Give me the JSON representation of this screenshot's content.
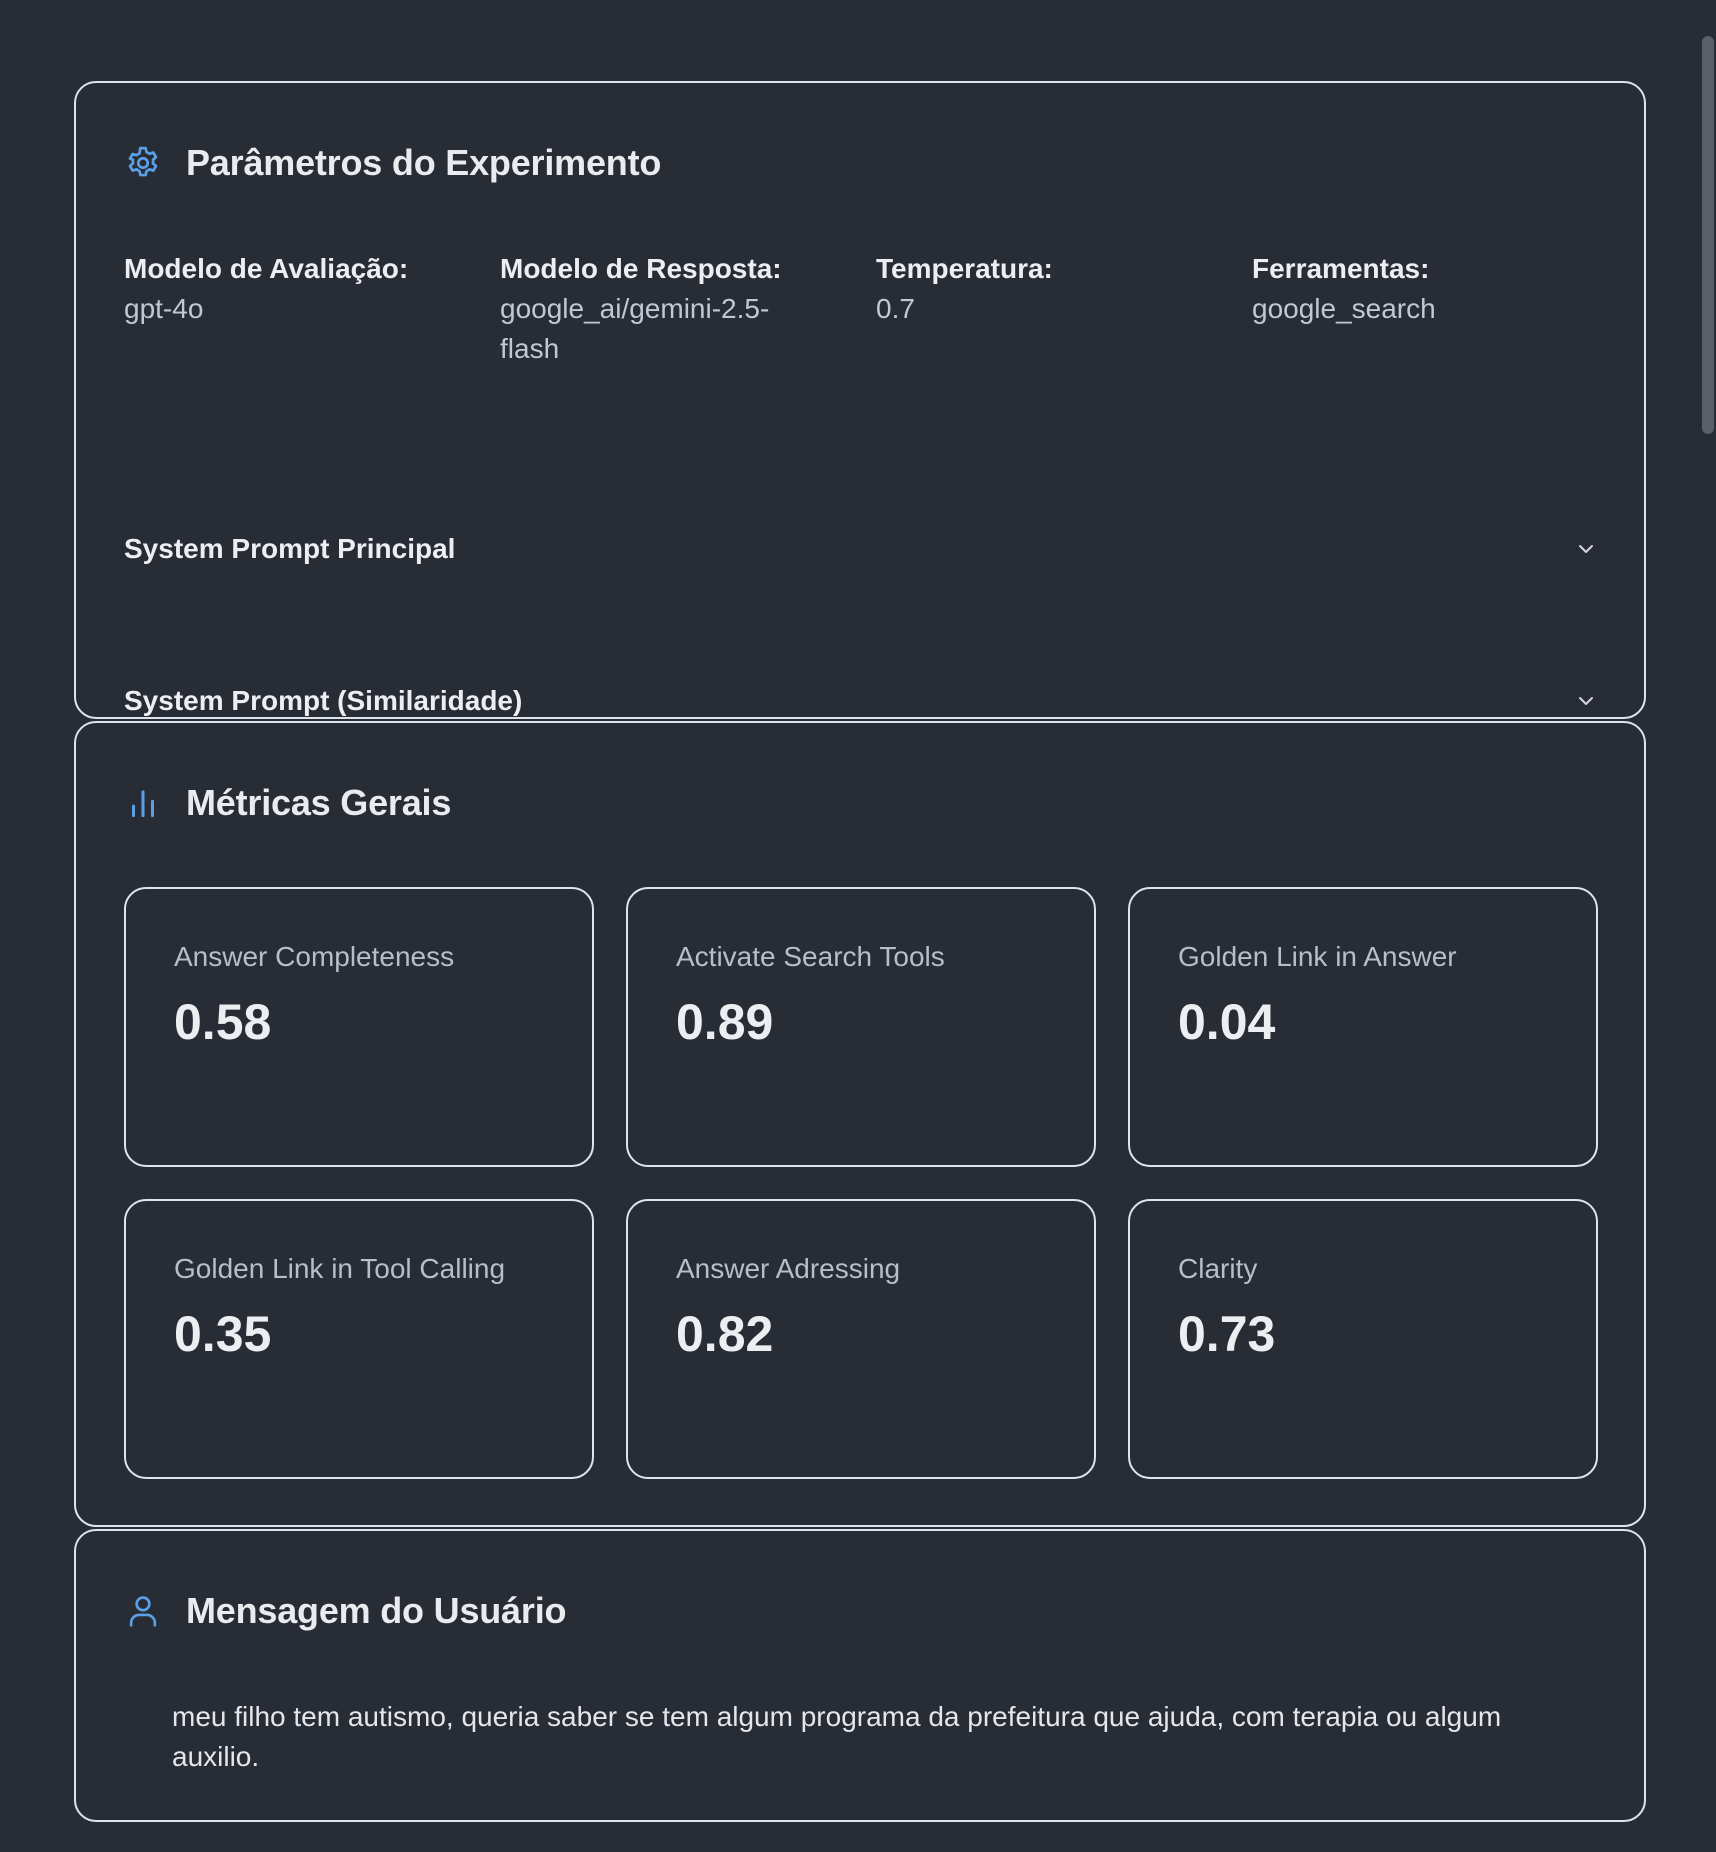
{
  "params_card": {
    "title": "Parâmetros do Experimento",
    "icon": "gear-icon",
    "fields": [
      {
        "label": "Modelo de Avaliação:",
        "value": "gpt-4o"
      },
      {
        "label": "Modelo de Resposta:",
        "value": "google_ai/gemini-2.5-flash"
      },
      {
        "label": "Temperatura:",
        "value": "0.7"
      },
      {
        "label": "Ferramentas:",
        "value": "google_search"
      }
    ],
    "system_prompt_main": "System Prompt Principal",
    "system_prompt_similarity": "System Prompt (Similaridade)"
  },
  "metrics_card": {
    "title": "Métricas Gerais",
    "icon": "bar-chart-icon",
    "metrics": [
      {
        "label": "Answer Completeness",
        "value": "0.58"
      },
      {
        "label": "Activate Search Tools",
        "value": "0.89"
      },
      {
        "label": "Golden Link in Answer",
        "value": "0.04"
      },
      {
        "label": "Golden Link in Tool Calling",
        "value": "0.35"
      },
      {
        "label": "Answer Adressing",
        "value": "0.82"
      },
      {
        "label": "Clarity",
        "value": "0.73"
      }
    ]
  },
  "message_card": {
    "title": "Mensagem do Usuário",
    "icon": "user-icon",
    "text": "meu filho tem autismo, queria saber se tem algum programa da prefeitura que ajuda, com terapia ou algum auxilio."
  },
  "colors": {
    "background": "#282c35",
    "border": "#dfe3ea",
    "accent_icon": "#5aa0e8"
  }
}
